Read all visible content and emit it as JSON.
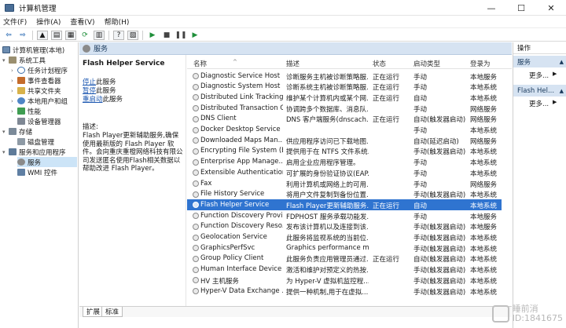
{
  "window": {
    "title": "计算机管理",
    "controls": {
      "minimize": "—",
      "maximize": "☐",
      "close": "✕"
    }
  },
  "menu": [
    "文件(F)",
    "操作(A)",
    "查看(V)",
    "帮助(H)"
  ],
  "tree": {
    "root": "计算机管理(本地)",
    "items": [
      "系统工具",
      "任务计划程序",
      "事件查看器",
      "共享文件夹",
      "本地用户和组",
      "性能",
      "设备管理器",
      "存储",
      "磁盘管理",
      "服务和应用程序",
      "服务",
      "WMI 控件"
    ]
  },
  "services_panel": {
    "header": "服务",
    "selected_service": "Flash Helper Service",
    "links": [
      {
        "link": "停止",
        "rest": "此服务"
      },
      {
        "link": "暂停",
        "rest": "此服务"
      },
      {
        "link": "重启动",
        "rest": "此服务"
      }
    ],
    "description_label": "描述:",
    "description": "Flash Player更新辅助服务,确保使用最新版的 Flash Player 软件。会向重庆重橙网络科技有限公司发送匿名使用Flash相关数据以帮助改进 Flash Player。"
  },
  "columns": {
    "name": "名称",
    "desc": "描述",
    "state": "状态",
    "startup": "启动类型",
    "logon": "登录为"
  },
  "rows": [
    {
      "name": "Diagnostic Service Host",
      "desc": "诊断服务主机被诊断策略服...",
      "state": "正在运行",
      "startup": "手动",
      "logon": "本地服务"
    },
    {
      "name": "Diagnostic System Host",
      "desc": "诊断系统主机被诊断策略服...",
      "state": "正在运行",
      "startup": "手动",
      "logon": "本地系统"
    },
    {
      "name": "Distributed Link Tracking...",
      "desc": "维护某个计算机内或某个网...",
      "state": "正在运行",
      "startup": "自动",
      "logon": "本地系统"
    },
    {
      "name": "Distributed Transaction C...",
      "desc": "协调跨多个数据库、消息队...",
      "state": "",
      "startup": "手动",
      "logon": "网络服务"
    },
    {
      "name": "DNS Client",
      "desc": "DNS 客户端服务(dnscach...",
      "state": "正在运行",
      "startup": "自动(触发器启动)",
      "logon": "网络服务"
    },
    {
      "name": "Docker Desktop Service",
      "desc": "",
      "state": "",
      "startup": "手动",
      "logon": "本地系统"
    },
    {
      "name": "Downloaded Maps Man...",
      "desc": "供应用程序访问已下载地图...",
      "state": "",
      "startup": "自动(延迟启动)",
      "logon": "网络服务"
    },
    {
      "name": "Encrypting File System (E...",
      "desc": "提供用于在 NTFS 文件系统...",
      "state": "",
      "startup": "手动(触发器启动)",
      "logon": "本地系统"
    },
    {
      "name": "Enterprise App Manage...",
      "desc": "启用企业应用程序管理。",
      "state": "",
      "startup": "手动",
      "logon": "本地系统"
    },
    {
      "name": "Extensible Authentication...",
      "desc": "可扩展的身份验证协议(EAP...",
      "state": "",
      "startup": "手动",
      "logon": "本地系统"
    },
    {
      "name": "Fax",
      "desc": "利用计算机或网络上的可用...",
      "state": "",
      "startup": "手动",
      "logon": "网络服务"
    },
    {
      "name": "File History Service",
      "desc": "将用户文件复制到备份位置...",
      "state": "",
      "startup": "手动(触发器启动)",
      "logon": "本地系统"
    },
    {
      "name": "Flash Helper Service",
      "desc": "Flash Player更新辅助服务...",
      "state": "正在运行",
      "startup": "自动",
      "logon": "本地系统",
      "selected": true
    },
    {
      "name": "Function Discovery Provi...",
      "desc": "FDPHOST 服务承载功能发...",
      "state": "",
      "startup": "手动",
      "logon": "本地服务"
    },
    {
      "name": "Function Discovery Reso...",
      "desc": "发布该计算机以及连接到该...",
      "state": "",
      "startup": "手动(触发器启动)",
      "logon": "本地服务"
    },
    {
      "name": "Geolocation Service",
      "desc": "此服务将监视系统的当前位...",
      "state": "",
      "startup": "手动(触发器启动)",
      "logon": "本地系统"
    },
    {
      "name": "GraphicsPerfSvc",
      "desc": "Graphics performance m...",
      "state": "",
      "startup": "手动(触发器启动)",
      "logon": "本地系统"
    },
    {
      "name": "Group Policy Client",
      "desc": "此服务负责应用管理员通过...",
      "state": "正在运行",
      "startup": "自动(触发器启动)",
      "logon": "本地系统"
    },
    {
      "name": "Human Interface Device ...",
      "desc": "激活和维护对预定义的热按...",
      "state": "",
      "startup": "手动(触发器启动)",
      "logon": "本地系统"
    },
    {
      "name": "HV 主机服务",
      "desc": "为 Hyper-V 虚拟机监控程...",
      "state": "",
      "startup": "手动(触发器启动)",
      "logon": "本地系统"
    },
    {
      "name": "Hyper-V Data Exchange ...",
      "desc": "提供一种机制,用于在虚拟...",
      "state": "",
      "startup": "手动(触发器启动)",
      "logon": "本地系统"
    }
  ],
  "tabs": [
    "扩展",
    "标准"
  ],
  "actions_panel": {
    "title": "操作",
    "sections": [
      {
        "label": "服务",
        "more": "更多..."
      },
      {
        "label": "Flash Hel...",
        "more": "更多..."
      }
    ]
  },
  "watermark": {
    "line1": "睡前消",
    "line2": "ID:1841675"
  }
}
